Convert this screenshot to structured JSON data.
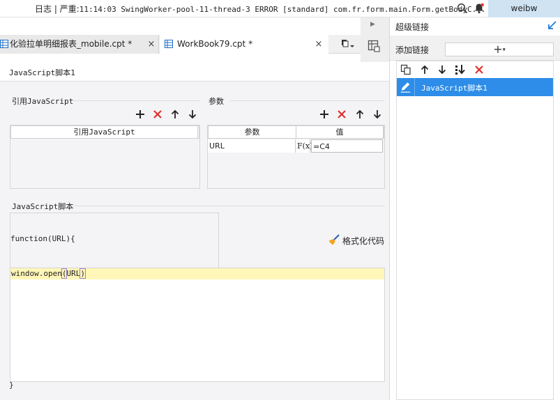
{
  "topbar": {
    "log_prefix": "日志 | 严重:",
    "log_detail": "11:14:03 SwingWorker-pool-11-thread-3 ERROR [standard] com.fr.form.main.Form.getBodyC...",
    "user": "weibw"
  },
  "tabs": [
    {
      "label": "化验拉单明细报表_mobile.cpt *",
      "close": "×"
    },
    {
      "label": "WorkBook79.cpt *",
      "close": "×"
    }
  ],
  "panel": {
    "header": "JavaScript脚本1",
    "ref_section_title": "引用JavaScript",
    "ref_table_header": "引用JavaScript",
    "params_section_title": "参数",
    "params_headers": [
      "参数",
      "值"
    ],
    "params_rows": [
      {
        "name": "URL",
        "formula_icon": "F(x)",
        "value": "=C4"
      }
    ],
    "script_section_title": "JavaScript脚本",
    "func_signature": "function(URL){",
    "format_button": "格式化代码",
    "code_prefix": "window.open",
    "code_open": "(",
    "code_arg": "URL",
    "code_close": ")",
    "closing_brace": "}"
  },
  "right_panel": {
    "title": "超级链接",
    "add_label": "添加链接",
    "add_button": "+",
    "add_caret": "▾",
    "items": [
      {
        "label": "JavaScript脚本1"
      }
    ]
  }
}
